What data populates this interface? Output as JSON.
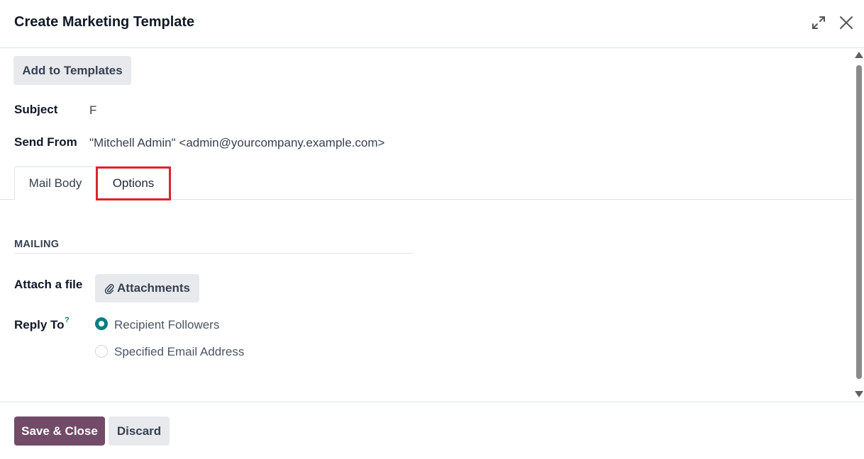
{
  "dialog": {
    "title": "Create Marketing Template",
    "expand_icon": "expand-icon",
    "close_icon": "close-icon"
  },
  "toolbar": {
    "add_to_templates_label": "Add to Templates"
  },
  "fields": {
    "subject_label": "Subject",
    "subject_value": "F",
    "send_from_label": "Send From",
    "send_from_value": "\"Mitchell Admin\" <admin@yourcompany.example.com>"
  },
  "tabs": [
    {
      "label": "Mail Body",
      "active": false
    },
    {
      "label": "Options",
      "active": true,
      "highlighted": true
    }
  ],
  "mailing": {
    "section_title": "MAILING",
    "attach_label": "Attach a file",
    "attachments_button": "Attachments",
    "attachments_icon": "paperclip-icon",
    "reply_to_label": "Reply To",
    "reply_to_help": "?",
    "reply_options": [
      {
        "label": "Recipient Followers",
        "checked": true
      },
      {
        "label": "Specified Email Address",
        "checked": false
      }
    ]
  },
  "footer": {
    "save_label": "Save & Close",
    "discard_label": "Discard"
  },
  "colors": {
    "primary": "#714b67",
    "accent": "#017e84",
    "highlight": "#d7262c"
  }
}
